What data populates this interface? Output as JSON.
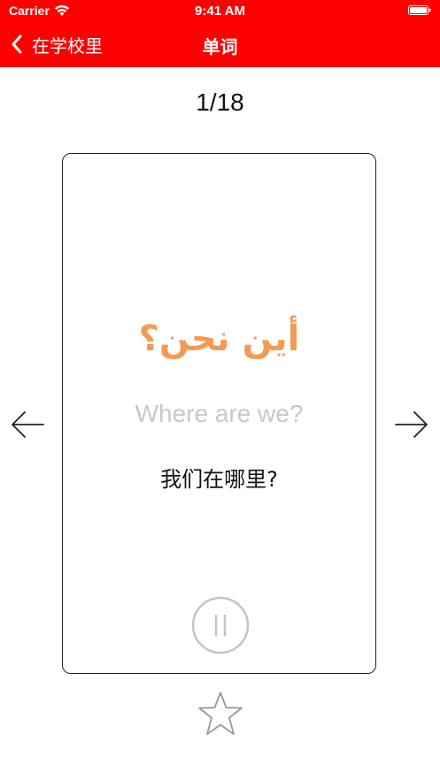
{
  "status_bar": {
    "carrier": "Carrier",
    "time": "9:41 AM",
    "wifi_icon": "wifi-icon",
    "battery_icon": "battery-icon"
  },
  "nav": {
    "back_label": "在学校里",
    "title": "单词",
    "back_icon": "chevron-left-icon",
    "background": "#ff0000"
  },
  "progress": {
    "counter": "1/18"
  },
  "card": {
    "arabic": "أين نحن؟",
    "english": "Where are we?",
    "chinese": "我们在哪里?",
    "play_icon": "pause-icon"
  },
  "controls": {
    "prev_icon": "arrow-left-icon",
    "next_icon": "arrow-right-icon",
    "favorite_icon": "star-outline-icon"
  },
  "colors": {
    "accent": "#ff0000",
    "arabic_text": "#f59a55",
    "english_text": "#c8c8c8"
  }
}
